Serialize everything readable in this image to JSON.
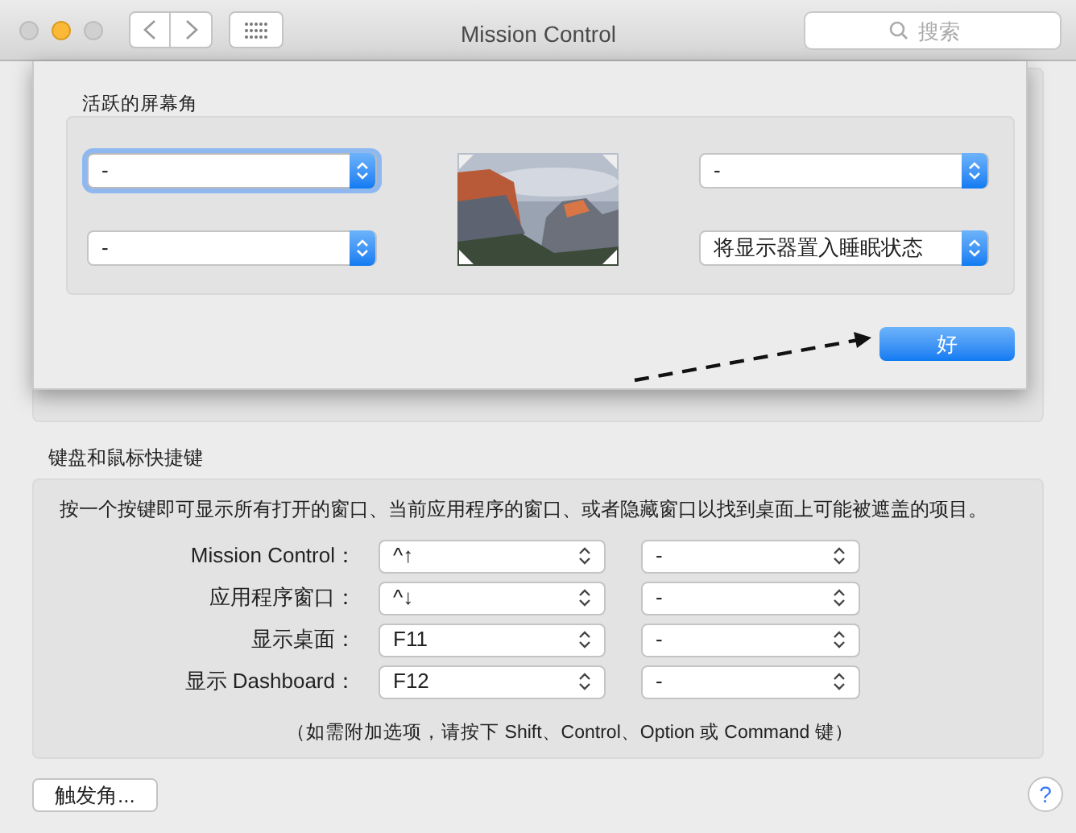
{
  "window": {
    "title": "Mission Control",
    "search_placeholder": "搜索"
  },
  "sheet": {
    "title": "活跃的屏幕角",
    "corners": [
      {
        "value": "-",
        "focused": true
      },
      {
        "value": "-",
        "focused": false
      },
      {
        "value": "-",
        "focused": false
      },
      {
        "value": "将显示器置入睡眠状态",
        "focused": false
      }
    ],
    "ok_button": "好"
  },
  "shortcuts": {
    "title": "键盘和鼠标快捷键",
    "description": "按一个按键即可显示所有打开的窗口、当前应用程序的窗口、或者隐藏窗口以找到桌面上可能被遮盖的项目。",
    "rows": [
      {
        "label": "Mission Control：",
        "key": "^↑",
        "mouse": "-"
      },
      {
        "label": "应用程序窗口：",
        "key": "^↓",
        "mouse": "-"
      },
      {
        "label": "显示桌面：",
        "key": "F11",
        "mouse": "-"
      },
      {
        "label": "显示 Dashboard：",
        "key": "F12",
        "mouse": "-"
      }
    ],
    "note": "（如需附加选项，请按下 Shift、Control、Option 或 Command 键）"
  },
  "hot_corners_button": "触发角...",
  "help_button": "?"
}
